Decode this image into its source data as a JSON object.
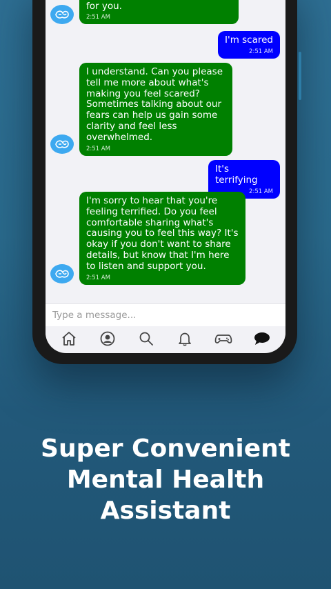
{
  "chat": {
    "messages": [
      {
        "from": "bot",
        "text": "listen and offer any support or resources that may be helpful for you.",
        "time": "2:51 AM"
      },
      {
        "from": "user",
        "text": "I'm scared",
        "time": "2:51 AM"
      },
      {
        "from": "bot",
        "text": "I understand. Can you please tell me more about what's making you feel scared? Sometimes talking about our fears can help us gain some clarity and feel less overwhelmed.",
        "time": "2:51 AM"
      },
      {
        "from": "user",
        "text": "It's terrifying",
        "time": "2:51 AM"
      },
      {
        "from": "bot",
        "text": "I'm sorry to hear that you're feeling terrified. Do you feel comfortable sharing what's causing you to feel this way? It's okay if you don't want to share details, but know that I'm here to listen and support you.",
        "time": "2:51 AM"
      }
    ]
  },
  "input": {
    "placeholder": "Type a message..."
  },
  "nav": {
    "items": [
      {
        "icon": "home-icon"
      },
      {
        "icon": "profile-icon"
      },
      {
        "icon": "search-icon"
      },
      {
        "icon": "bell-icon"
      },
      {
        "icon": "gamepad-icon"
      },
      {
        "icon": "chat-icon",
        "active": true
      }
    ]
  },
  "promo": {
    "line1": "Super Convenient",
    "line2": "Mental Health",
    "line3": "Assistant"
  },
  "colors": {
    "bot_bubble": "#008000",
    "user_bubble": "#0000ff",
    "avatar": "#3da9f0",
    "background": "#2a6a8c"
  }
}
